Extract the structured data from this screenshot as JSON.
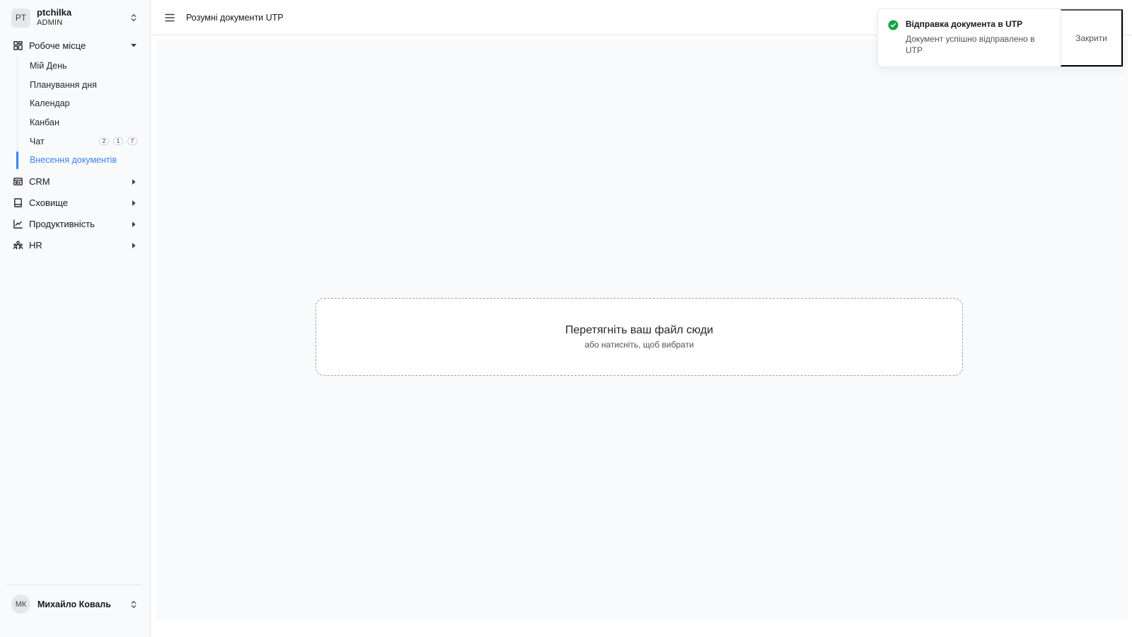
{
  "org": {
    "initials": "PT",
    "name": "ptchilka",
    "role": "ADMIN"
  },
  "nav": {
    "workspace": {
      "label": "Робоче місце",
      "items": [
        {
          "label": "Мій День"
        },
        {
          "label": "Планування дня"
        },
        {
          "label": "Календар"
        },
        {
          "label": "Канбан"
        },
        {
          "label": "Чат",
          "badges": [
            "2",
            "1",
            "7"
          ]
        },
        {
          "label": "Внесення документів",
          "active": true
        }
      ]
    },
    "groups": [
      {
        "label": "CRM",
        "icon": "crm-icon"
      },
      {
        "label": "Сховище",
        "icon": "storage-icon"
      },
      {
        "label": "Продуктивність",
        "icon": "chart-line-icon"
      },
      {
        "label": "HR",
        "icon": "people-icon"
      }
    ]
  },
  "user": {
    "initials": "МК",
    "name": "Михайло Коваль"
  },
  "topbar": {
    "title": "Розумні документи UTP"
  },
  "dropzone": {
    "title": "Перетягніть ваш файл сюди",
    "subtitle": "або натисніть, щоб вибрати"
  },
  "toast": {
    "title": "Відправка документа в UTP",
    "description": "Документ успішно відправлено в UTP",
    "close_label": "Закрити"
  },
  "colors": {
    "accent": "#3b82f6",
    "success": "#16a34a"
  }
}
